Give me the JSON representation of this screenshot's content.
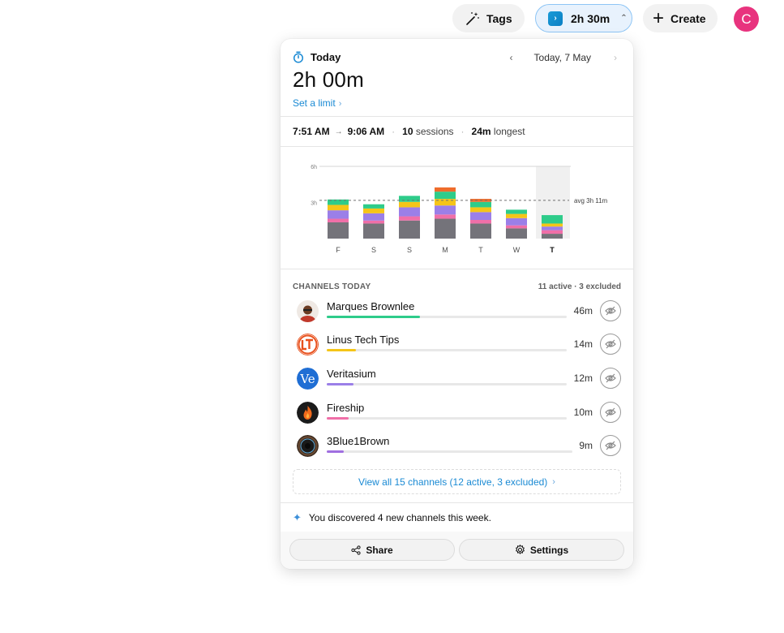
{
  "topbar": {
    "tags_label": "Tags",
    "time_label": "2h 30m",
    "create_label": "Create",
    "avatar_letter": "C",
    "avatar_color": "#e8337e"
  },
  "panel": {
    "today_label": "Today",
    "date_label": "Today, 7 May",
    "total_time": "2h 00m",
    "limit_link": "Set a limit",
    "sessions": {
      "start": "7:51 AM",
      "arrow": "→",
      "end": "9:06 AM",
      "count": "10",
      "count_suffix": "sessions",
      "longest": "24m",
      "longest_suffix": "longest"
    },
    "channels_heading": "CHANNELS TODAY",
    "channels_summary": "11 active · 3 excluded",
    "channels": [
      {
        "name": "Marques Brownlee",
        "duration": "46m",
        "share": 0.39,
        "color": "#2ecc8a",
        "icon": "marques-avatar"
      },
      {
        "name": "Linus Tech Tips",
        "duration": "14m",
        "share": 0.12,
        "color": "#f5c518",
        "icon": "ltt-logo"
      },
      {
        "name": "Veritasium",
        "duration": "12m",
        "share": 0.11,
        "color": "#9b7fe8",
        "icon": "veritasium-logo"
      },
      {
        "name": "Fireship",
        "duration": "10m",
        "share": 0.09,
        "color": "#f06fa8",
        "icon": "fireship-logo"
      },
      {
        "name": "3Blue1Brown",
        "duration": "9m",
        "share": 0.07,
        "color": "#a06fe0",
        "icon": "3b1b-logo"
      }
    ],
    "view_all": "View all 15 channels (12 active, 3 excluded)",
    "discovery": "You discovered 4 new channels this week.",
    "share_label": "Share",
    "settings_label": "Settings"
  },
  "chart_data": {
    "type": "bar",
    "stacked": true,
    "categories": [
      "F",
      "S",
      "S",
      "M",
      "T",
      "W",
      "T"
    ],
    "current_index": 6,
    "ylim": [
      0,
      6
    ],
    "y_ticks": [
      {
        "value": 6,
        "label": "6h"
      },
      {
        "value": 3,
        "label": "3h"
      }
    ],
    "average": {
      "value": 3.18,
      "label": "avg 3h 11m"
    },
    "series": [
      {
        "color": "#74737a",
        "values": [
          1.35,
          1.25,
          1.5,
          1.65,
          1.25,
          0.85,
          0.4
        ]
      },
      {
        "color": "#f06fa8",
        "values": [
          0.3,
          0.25,
          0.35,
          0.35,
          0.3,
          0.25,
          0.3
        ]
      },
      {
        "color": "#9b7fe8",
        "values": [
          0.7,
          0.6,
          0.75,
          0.75,
          0.65,
          0.6,
          0.3
        ]
      },
      {
        "color": "#f5c518",
        "values": [
          0.45,
          0.4,
          0.45,
          0.55,
          0.4,
          0.35,
          0.25
        ]
      },
      {
        "color": "#2ecc8a",
        "values": [
          0.45,
          0.35,
          0.5,
          0.6,
          0.45,
          0.35,
          0.7
        ]
      },
      {
        "color": "#ef6c2b",
        "values": [
          0,
          0,
          0,
          0.35,
          0.25,
          0,
          0
        ]
      }
    ]
  }
}
